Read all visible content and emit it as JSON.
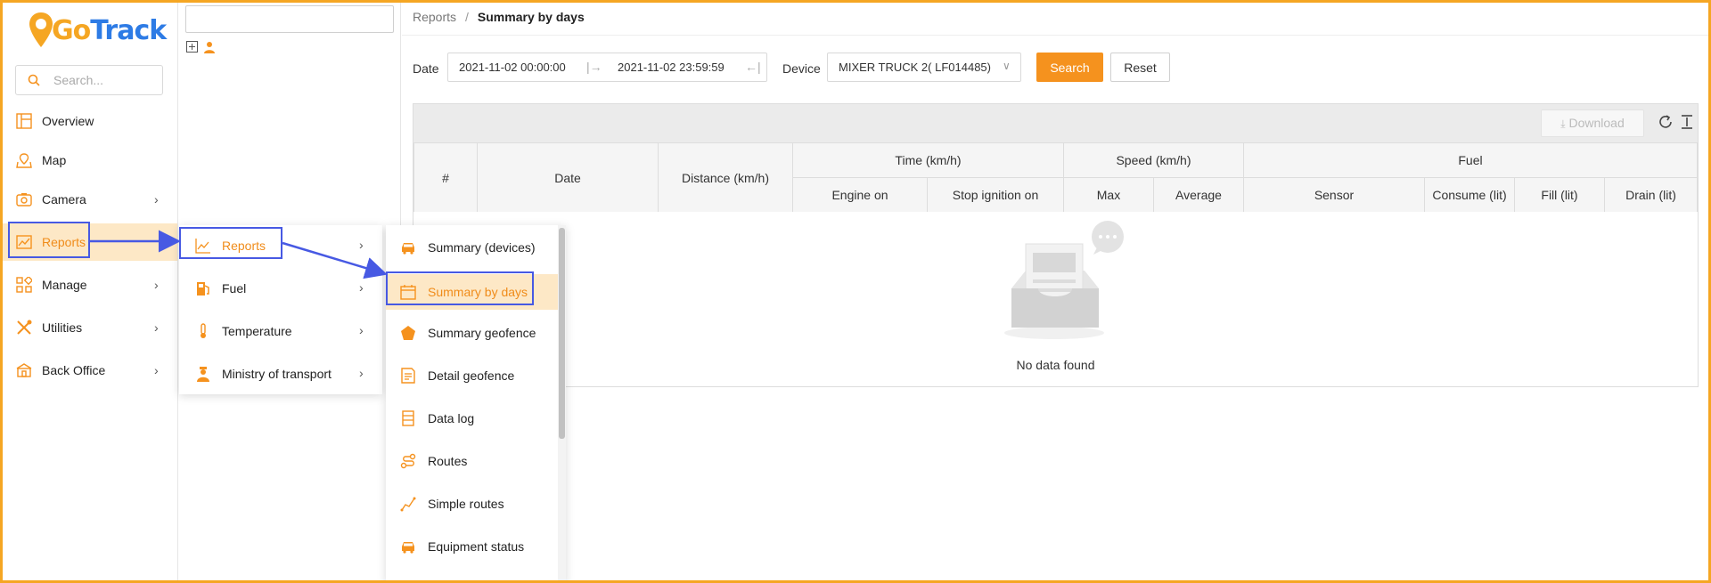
{
  "logo": {
    "go": "Go",
    "track": "Track"
  },
  "sidebar": {
    "search_placeholder": "Search...",
    "items": [
      {
        "label": "Overview",
        "icon": "overview-icon"
      },
      {
        "label": "Map",
        "icon": "map-icon"
      },
      {
        "label": "Camera",
        "icon": "camera-icon"
      },
      {
        "label": "Reports",
        "icon": "reports-icon"
      },
      {
        "label": "Manage",
        "icon": "manage-icon"
      },
      {
        "label": "Utilities",
        "icon": "utilities-icon"
      },
      {
        "label": "Back Office",
        "icon": "back-office-icon"
      }
    ]
  },
  "breadcrumb": {
    "parent": "Reports",
    "separator": "/",
    "current": "Summary by days"
  },
  "filters": {
    "date_label": "Date",
    "date_from": "2021-11-02 00:00:00",
    "date_to": "2021-11-02 23:59:59",
    "device_label": "Device",
    "device_value": "MIXER TRUCK 2( LF014485)",
    "search_button": "Search",
    "reset_button": "Reset"
  },
  "toolbar": {
    "download_label": "Download"
  },
  "table": {
    "col_index": "#",
    "col_date": "Date",
    "col_distance": "Distance (km/h)",
    "group_time": "Time (km/h)",
    "group_speed": "Speed (km/h)",
    "group_fuel": "Fuel",
    "col_engine_on": "Engine on",
    "col_stop_ignition": "Stop ignition on",
    "col_max": "Max",
    "col_average": "Average",
    "col_sensor": "Sensor",
    "col_consume": "Consume (lit)",
    "col_fill": "Fill (lit)",
    "col_drain": "Drain (lit)",
    "empty_text": "No data found"
  },
  "menu_level1": [
    {
      "label": "Reports",
      "icon": "chart-icon",
      "active": true
    },
    {
      "label": "Fuel",
      "icon": "fuel-pump-icon"
    },
    {
      "label": "Temperature",
      "icon": "thermometer-icon"
    },
    {
      "label": "Ministry of transport",
      "icon": "officer-icon"
    }
  ],
  "menu_level2": [
    {
      "label": "Summary (devices)",
      "icon": "car-icon"
    },
    {
      "label": "Summary by days",
      "icon": "calendar-icon",
      "active": true
    },
    {
      "label": "Summary geofence",
      "icon": "pentagon-icon"
    },
    {
      "label": "Detail geofence",
      "icon": "document-icon"
    },
    {
      "label": "Data log",
      "icon": "data-log-icon"
    },
    {
      "label": "Routes",
      "icon": "routes-icon"
    },
    {
      "label": "Simple routes",
      "icon": "simple-routes-icon"
    },
    {
      "label": "Equipment status",
      "icon": "car-icon"
    }
  ],
  "colors": {
    "accent": "#f5921e",
    "highlight_bg": "#fde8c6",
    "annotation": "#4759e3",
    "logo_blue": "#2d7be5"
  }
}
